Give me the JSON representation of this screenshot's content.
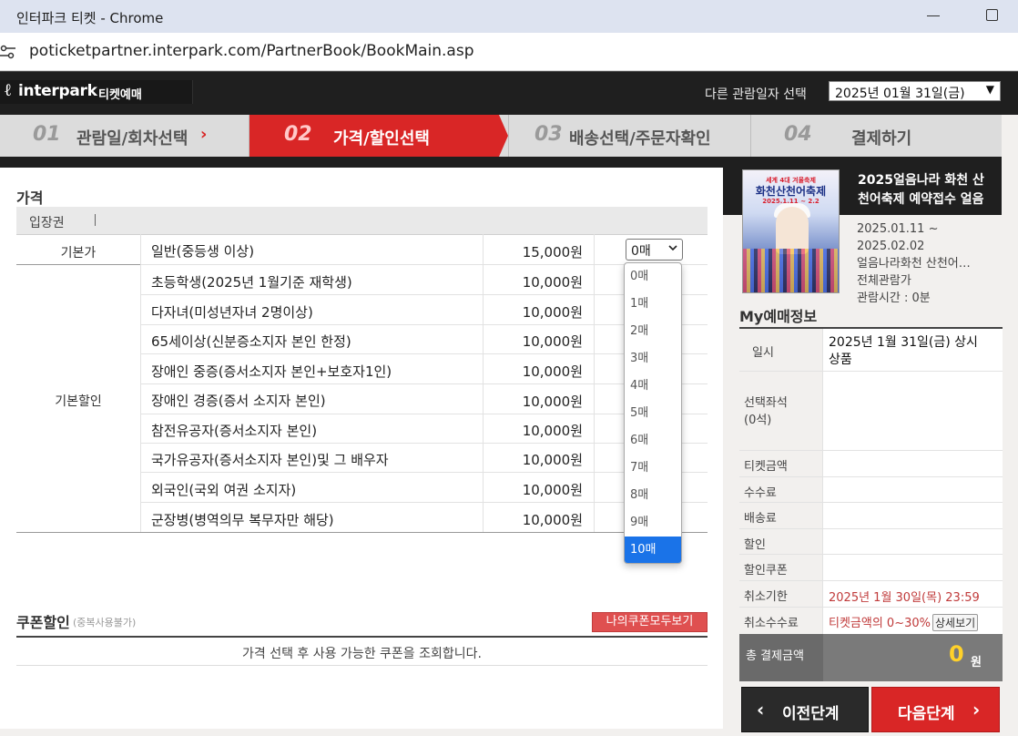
{
  "window": {
    "title": "인터파크 티켓 - Chrome",
    "url": "poticketpartner.interpark.com/PartnerBook/BookMain.asp"
  },
  "header": {
    "logo_brand": "interpark",
    "logo_sub": "티켓예매",
    "other_date_label": "다른 관람일자 선택",
    "date_value": "2025년 01월 31일(금)"
  },
  "steps": [
    {
      "num": "01",
      "label": "관람일/회차선택",
      "state": "done"
    },
    {
      "num": "02",
      "label": "가격/할인선택",
      "state": "active"
    },
    {
      "num": "03",
      "label": "배송선택/주문자확인",
      "state": "pending"
    },
    {
      "num": "04",
      "label": "결제하기",
      "state": "pending"
    }
  ],
  "price": {
    "section_title": "가격",
    "ticket_type": "입장권",
    "cat_basic": "기본가",
    "cat_discount": "기본할인",
    "qty_value": "0매",
    "rows": [
      {
        "name": "일반(중등생 이상)",
        "price": "15,000원"
      },
      {
        "name": "초등학생(2025년 1월기준 재학생)",
        "price": "10,000원"
      },
      {
        "name": "다자녀(미성년자녀 2명이상)",
        "price": "10,000원"
      },
      {
        "name": "65세이상(신분증소지자 본인 한정)",
        "price": "10,000원"
      },
      {
        "name": "장애인 중증(증서소지자 본인+보호자1인)",
        "price": "10,000원"
      },
      {
        "name": "장애인 경증(증서 소지자 본인)",
        "price": "10,000원"
      },
      {
        "name": "참전유공자(증서소지자 본인)",
        "price": "10,000원"
      },
      {
        "name": "국가유공자(증서소지자 본인)및 그 배우자",
        "price": "10,000원"
      },
      {
        "name": "외국인(국외 여권 소지자)",
        "price": "10,000원"
      },
      {
        "name": "군장병(병역의무 복무자만 해당)",
        "price": "10,000원"
      }
    ],
    "qty_options": [
      "0매",
      "1매",
      "2매",
      "3매",
      "4매",
      "5매",
      "6매",
      "7매",
      "8매",
      "9매",
      "10매"
    ],
    "qty_highlighted": "10매"
  },
  "coupon": {
    "title": "쿠폰할인",
    "note": "(중복사용불가)",
    "button": "나의쿠폰모두보기",
    "message": "가격 선택 후 사용 가능한 쿠폰을 조회합니다."
  },
  "show": {
    "title": "2025얼음나라 화천 산천어축제 예약접수 얼음",
    "period_start": "2025.01.11 ~",
    "period_end": "2025.02.02",
    "venue": "얼음나라화천 산천어…",
    "rating": "전체관람가",
    "runtime": "관람시간 : 0분",
    "poster_top": "세계 4대 겨울축제",
    "poster_title": "화천산천어축제",
    "poster_dates": "2025.1.11 ~ 2.2"
  },
  "my_booking": {
    "title": "My예매정보",
    "date_key": "일시",
    "date_value_1": "2025년 1월 31일(금) 상시",
    "date_value_2": "상품",
    "seat_key_1": "선택좌석",
    "seat_key_2": "(0석)",
    "ticket_amount_key": "티켓금액",
    "fee_key": "수수료",
    "delivery_key": "배송료",
    "discount_key": "할인",
    "coupon_key": "할인쿠폰",
    "cancel_deadline_key": "취소기한",
    "cancel_deadline_value": "2025년 1월 30일(목) 23:59",
    "cancel_fee_key": "취소수수료",
    "cancel_fee_value": "티켓금액의 0~30%",
    "detail_button": "상세보기",
    "total_key": "총 결제금액",
    "total_amount": "0",
    "total_unit": "원"
  },
  "nav": {
    "prev": "이전단계",
    "next": "다음단계"
  },
  "colors": {
    "accent": "#d92626",
    "header_bg": "#1f1f1f",
    "highlight": "#1a73e8",
    "total_amount": "#ffd12a"
  }
}
